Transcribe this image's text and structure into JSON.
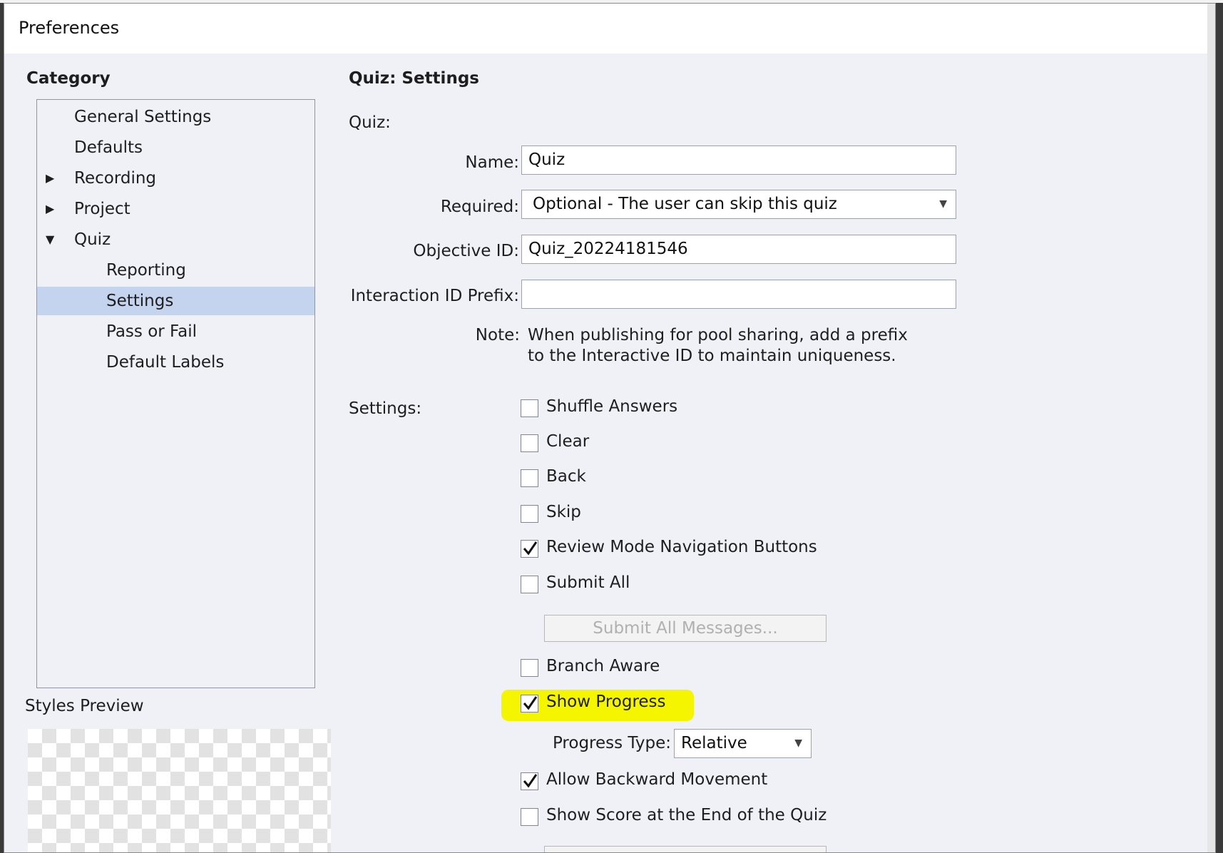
{
  "window": {
    "title": "Preferences"
  },
  "category": {
    "heading": "Category",
    "items": [
      {
        "label": "General Settings",
        "level": 0,
        "arrow": ""
      },
      {
        "label": "Defaults",
        "level": 0,
        "arrow": ""
      },
      {
        "label": "Recording",
        "level": 0,
        "arrow": "▶"
      },
      {
        "label": "Project",
        "level": 0,
        "arrow": "▶"
      },
      {
        "label": "Quiz",
        "level": 0,
        "arrow": "▼"
      },
      {
        "label": "Reporting",
        "level": 1,
        "arrow": ""
      },
      {
        "label": "Settings",
        "level": 1,
        "arrow": "",
        "selected": true
      },
      {
        "label": "Pass or Fail",
        "level": 1,
        "arrow": ""
      },
      {
        "label": "Default Labels",
        "level": 1,
        "arrow": ""
      }
    ]
  },
  "styles_preview": {
    "label": "Styles Preview"
  },
  "panel": {
    "heading": "Quiz: Settings",
    "quiz_group_label": "Quiz:",
    "name_label": "Name:",
    "name_value": "Quiz",
    "required_label": "Required:",
    "required_value": "Optional - The user can skip this quiz",
    "objective_label": "Objective ID:",
    "objective_value": "Quiz_20224181546",
    "prefix_label": "Interaction ID Prefix:",
    "prefix_value": "",
    "note_label": "Note:",
    "note_line1": "When publishing for pool sharing, add a prefix",
    "note_line2": "to the Interactive ID to maintain uniqueness.",
    "settings_label": "Settings:",
    "checkboxes": {
      "shuffle": {
        "label": "Shuffle Answers",
        "checked": false
      },
      "clear": {
        "label": "Clear",
        "checked": false
      },
      "back": {
        "label": "Back",
        "checked": false
      },
      "skip": {
        "label": "Skip",
        "checked": false
      },
      "review": {
        "label": "Review Mode Navigation Buttons",
        "checked": true
      },
      "submit_all": {
        "label": "Submit All",
        "checked": false
      },
      "branch": {
        "label": "Branch Aware",
        "checked": false
      },
      "progress": {
        "label": "Show Progress",
        "checked": true
      },
      "backward": {
        "label": "Allow Backward Movement",
        "checked": true
      },
      "score": {
        "label": "Show Score at the End of the Quiz",
        "checked": false
      }
    },
    "submit_messages_button": "Submit All Messages...",
    "progress_type_label": "Progress Type:",
    "progress_type_value": "Relative",
    "highlight_color": "#f6f500"
  }
}
